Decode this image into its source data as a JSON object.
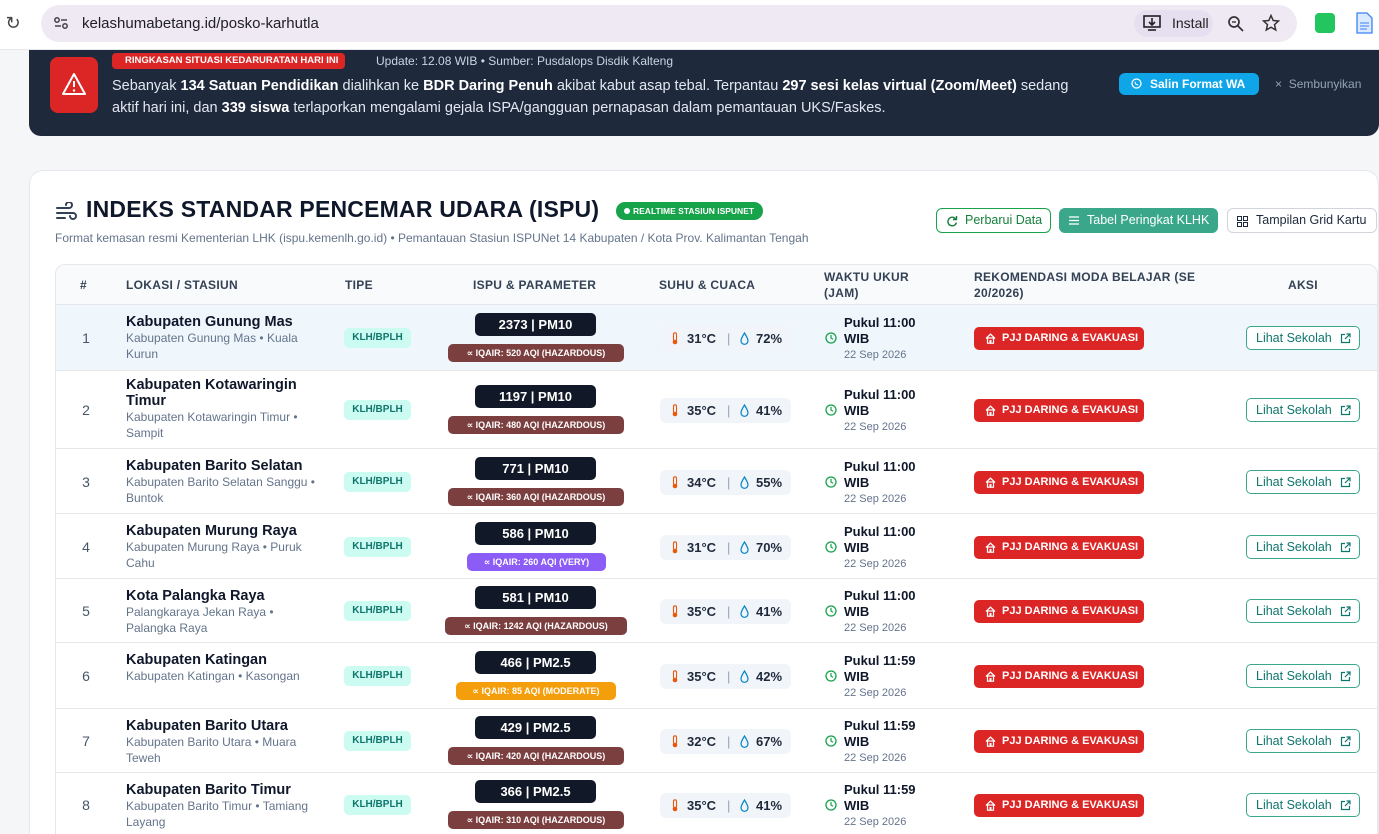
{
  "browser": {
    "url": "kelashumabetang.id/posko-karhutla",
    "install_label": "Install"
  },
  "alert": {
    "tag": "RINGKASAN SITUASI KEDARURATAN HARI INI",
    "meta": "Update: 12.08 WIB • Sumber: Pusdalops Disdik Kalteng",
    "text": {
      "p1": "Sebanyak ",
      "b1": "134 Satuan Pendidikan",
      "p2": " dialihkan ke ",
      "b2": "BDR Daring Penuh",
      "p3": " akibat kabut asap tebal. Terpantau ",
      "b3": "297 sesi kelas virtual (Zoom/Meet)",
      "p4": " sedang aktif hari ini, dan ",
      "b4": "339 siswa",
      "p5": " terlaporkan mengalami gejala ISPA/gangguan pernapasan dalam pemantauan UKS/Faskes."
    },
    "copy_label": "Salin Format WA",
    "hide_label": "Sembunyikan"
  },
  "section": {
    "title": "INDEKS STANDAR PENCEMAR UDARA (ISPU)",
    "badge": "REALTIME STASIUN ISPUNET",
    "subtitle": "Format kemasan resmi Kementerian LHK (ispu.kemenlh.go.id) • Pemantauan Stasiun ISPUNet 14 Kabupaten / Kota Prov. Kalimantan Tengah",
    "refresh_label": "Perbarui Data",
    "table_label": "Tabel Peringkat KLHK",
    "grid_label": "Tampilan Grid Kartu"
  },
  "table": {
    "headers": {
      "num": "#",
      "loc": "LOKASI / STASIUN",
      "type": "TIPE",
      "ispu": "ISPU & PARAMETER",
      "weather": "SUHU & CUACA",
      "time_l1": "WAKTU UKUR",
      "time_l2": "(JAM)",
      "rec_l1": "REKOMENDASI MODA BELAJAR (SE",
      "rec_l2": "20/2026)",
      "action": "AKSI"
    },
    "rows": [
      {
        "num": "1",
        "name": "Kabupaten Gunung Mas",
        "sub": "Kabupaten Gunung Mas • Kuala Kurun",
        "type": "KLH/BPLH",
        "ispu": "2373 | PM10",
        "aqi": "IQAIR: 520 AQI (HAZARDOUS)",
        "aqi_level": "hazardous",
        "temp": "31°C",
        "hum": "72%",
        "time": "Pukul 11:00 WIB",
        "date": "22 Sep 2026",
        "rec": "PJJ DARING & EVAKUASI",
        "action": "Lihat Sekolah"
      },
      {
        "num": "2",
        "name": "Kabupaten Kotawaringin Timur",
        "sub": "Kabupaten Kotawaringin Timur • Sampit",
        "type": "KLH/BPLH",
        "ispu": "1197 | PM10",
        "aqi": "IQAIR: 480 AQI (HAZARDOUS)",
        "aqi_level": "hazardous",
        "temp": "35°C",
        "hum": "41%",
        "time": "Pukul 11:00 WIB",
        "date": "22 Sep 2026",
        "rec": "PJJ DARING & EVAKUASI",
        "action": "Lihat Sekolah"
      },
      {
        "num": "3",
        "name": "Kabupaten Barito Selatan",
        "sub": "Kabupaten Barito Selatan Sanggu • Buntok",
        "type": "KLH/BPLH",
        "ispu": "771 | PM10",
        "aqi": "IQAIR: 360 AQI (HAZARDOUS)",
        "aqi_level": "hazardous",
        "temp": "34°C",
        "hum": "55%",
        "time": "Pukul 11:00 WIB",
        "date": "22 Sep 2026",
        "rec": "PJJ DARING & EVAKUASI",
        "action": "Lihat Sekolah"
      },
      {
        "num": "4",
        "name": "Kabupaten Murung Raya",
        "sub": "Kabupaten Murung Raya • Puruk Cahu",
        "type": "KLH/BPLH",
        "ispu": "586 | PM10",
        "aqi": "IQAIR: 260 AQI (VERY)",
        "aqi_level": "very",
        "temp": "31°C",
        "hum": "70%",
        "time": "Pukul 11:00 WIB",
        "date": "22 Sep 2026",
        "rec": "PJJ DARING & EVAKUASI",
        "action": "Lihat Sekolah"
      },
      {
        "num": "5",
        "name": "Kota Palangka Raya",
        "sub": "Palangkaraya Jekan Raya • Palangka Raya",
        "type": "KLH/BPLH",
        "ispu": "581 | PM10",
        "aqi": "IQAIR: 1242 AQI (HAZARDOUS)",
        "aqi_level": "hazardous",
        "temp": "35°C",
        "hum": "41%",
        "time": "Pukul 11:00 WIB",
        "date": "22 Sep 2026",
        "rec": "PJJ DARING & EVAKUASI",
        "action": "Lihat Sekolah"
      },
      {
        "num": "6",
        "name": "Kabupaten Katingan",
        "sub": "Kabupaten Katingan • Kasongan",
        "type": "KLH/BPLH",
        "ispu": "466 | PM2.5",
        "aqi": "IQAIR: 85 AQI (MODERATE)",
        "aqi_level": "moderate",
        "temp": "35°C",
        "hum": "42%",
        "time": "Pukul 11:59 WIB",
        "date": "22 Sep 2026",
        "rec": "PJJ DARING & EVAKUASI",
        "action": "Lihat Sekolah"
      },
      {
        "num": "7",
        "name": "Kabupaten Barito Utara",
        "sub": "Kabupaten Barito Utara • Muara Teweh",
        "type": "KLH/BPLH",
        "ispu": "429 | PM2.5",
        "aqi": "IQAIR: 420 AQI (HAZARDOUS)",
        "aqi_level": "hazardous",
        "temp": "32°C",
        "hum": "67%",
        "time": "Pukul 11:59 WIB",
        "date": "22 Sep 2026",
        "rec": "PJJ DARING & EVAKUASI",
        "action": "Lihat Sekolah"
      },
      {
        "num": "8",
        "name": "Kabupaten Barito Timur",
        "sub": "Kabupaten Barito Timur • Tamiang Layang",
        "type": "KLH/BPLH",
        "ispu": "366 | PM2.5",
        "aqi": "IQAIR: 310 AQI (HAZARDOUS)",
        "aqi_level": "hazardous",
        "temp": "35°C",
        "hum": "41%",
        "time": "Pukul 11:59 WIB",
        "date": "22 Sep 2026",
        "rec": "PJJ DARING & EVAKUASI",
        "action": "Lihat Sekolah"
      }
    ]
  }
}
